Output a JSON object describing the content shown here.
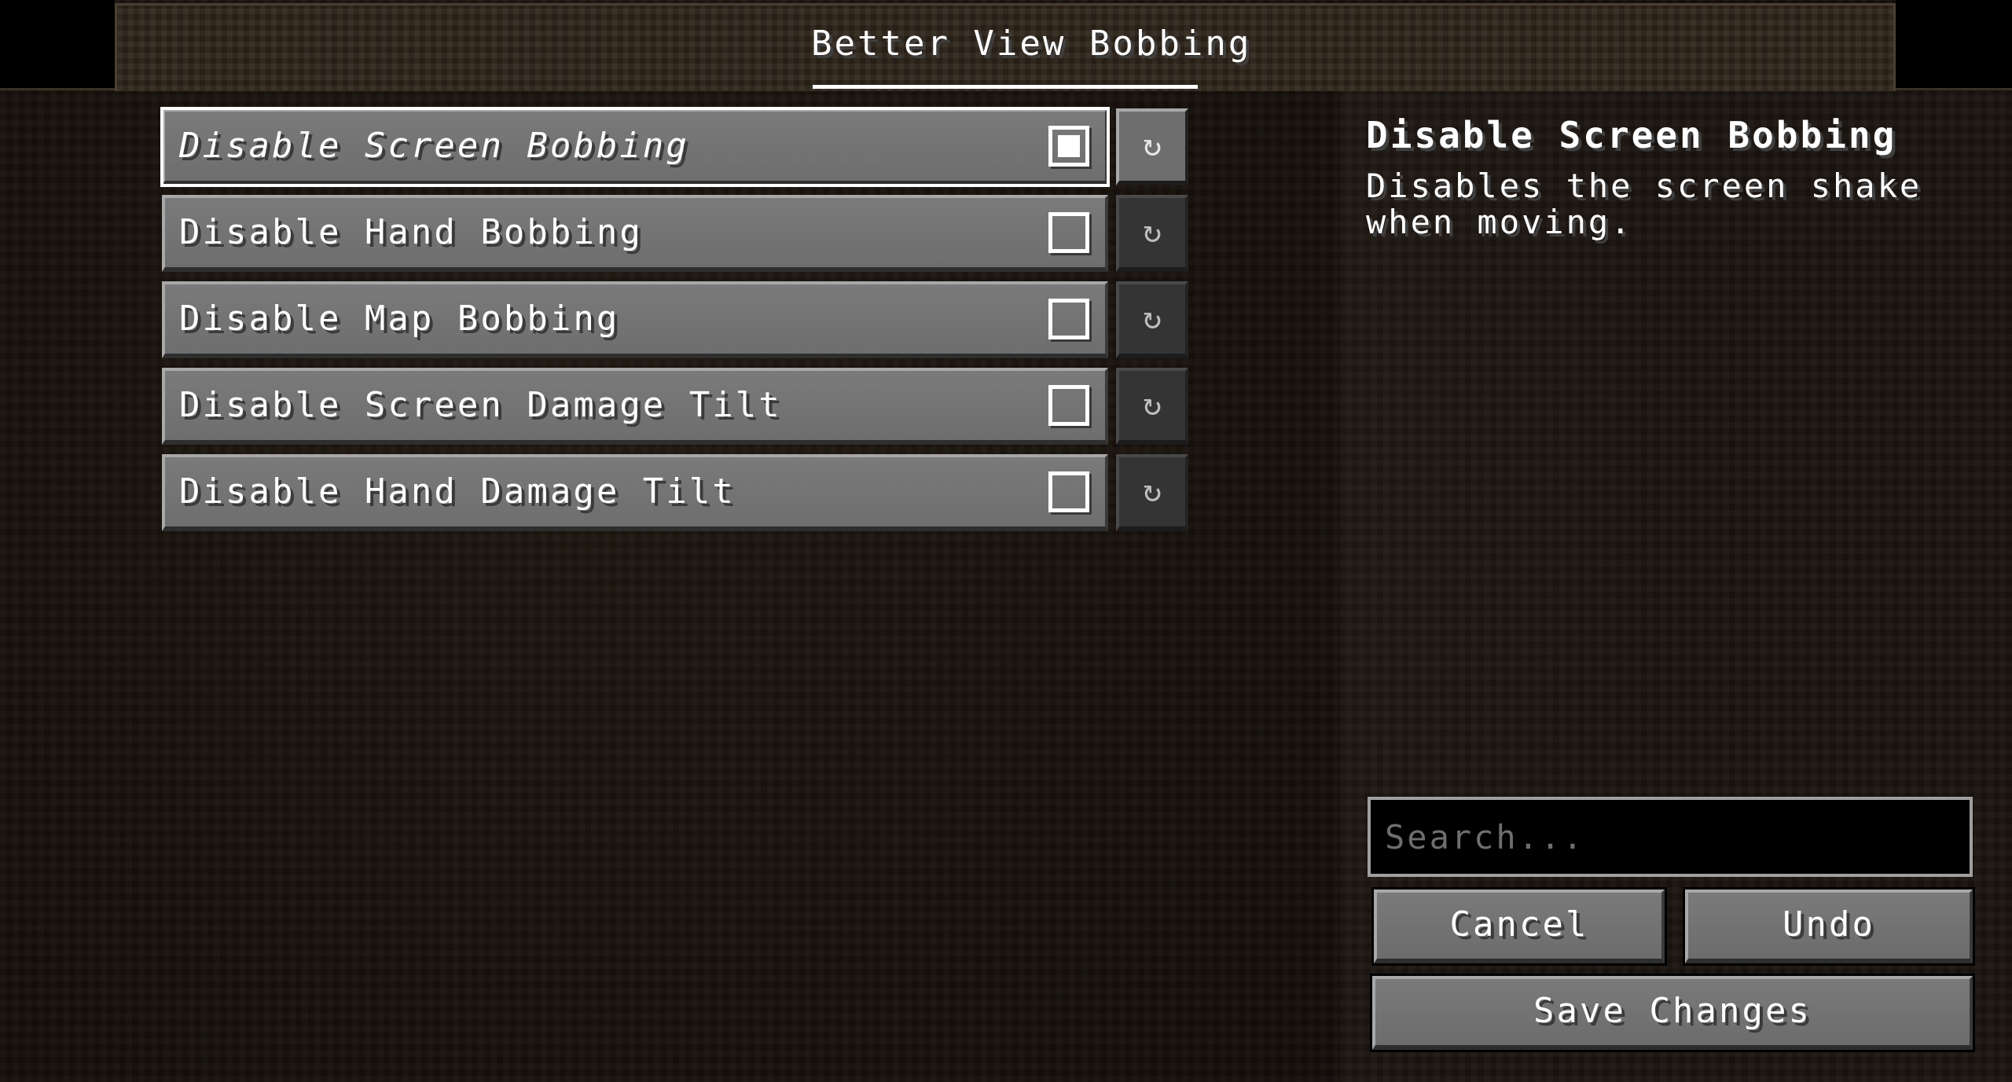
{
  "header": {
    "title": "Better View Bobbing"
  },
  "options": [
    {
      "label": "Disable Screen Bobbing",
      "checked": true,
      "focused": true
    },
    {
      "label": "Disable Hand Bobbing",
      "checked": false,
      "focused": false
    },
    {
      "label": "Disable Map Bobbing",
      "checked": false,
      "focused": false
    },
    {
      "label": "Disable Screen Damage Tilt",
      "checked": false,
      "focused": false
    },
    {
      "label": "Disable Hand Damage Tilt",
      "checked": false,
      "focused": false
    }
  ],
  "reset_icon": "↻",
  "icons": {
    "reset": "reset-icon",
    "checkbox": "checkbox-icon"
  },
  "info": {
    "title": "Disable Screen Bobbing",
    "description": "Disables the screen shake when moving."
  },
  "search": {
    "placeholder": "Search...",
    "value": ""
  },
  "actions": {
    "cancel": "Cancel",
    "undo": "Undo",
    "save": "Save Changes"
  },
  "colors": {
    "background": "#1a140f",
    "button": "#6e6e6e",
    "text": "#ffffff"
  }
}
